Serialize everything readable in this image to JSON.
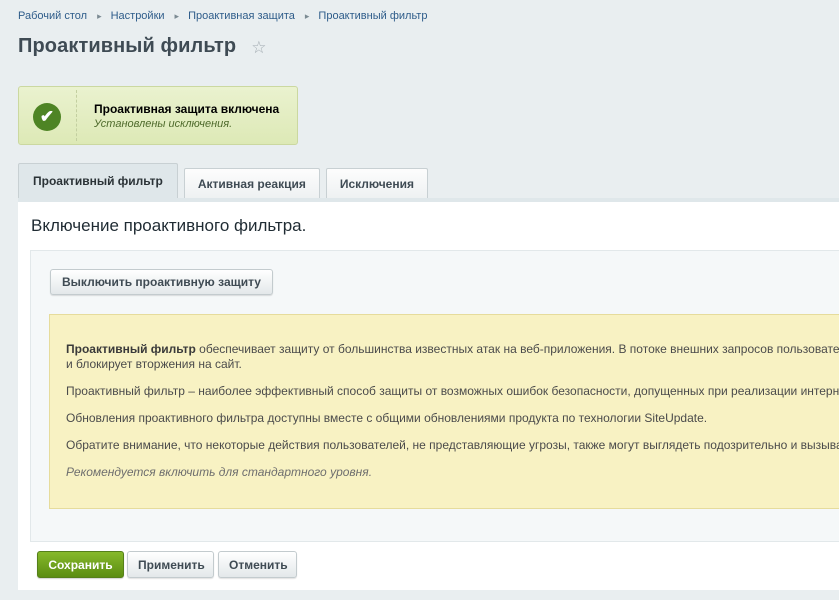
{
  "breadcrumb": {
    "items": [
      "Рабочий стол",
      "Настройки",
      "Проактивная защита",
      "Проактивный фильтр"
    ],
    "separator": "▸"
  },
  "page": {
    "title": "Проактивный фильтр",
    "favorite_icon": "star-icon"
  },
  "status": {
    "icon": "check-circle-icon",
    "title": "Проактивная защита включена",
    "subtitle": "Установлены исключения."
  },
  "tabs": [
    {
      "label": "Проактивный фильтр",
      "active": true
    },
    {
      "label": "Активная реакция",
      "active": false
    },
    {
      "label": "Исключения",
      "active": false
    }
  ],
  "main": {
    "heading": "Включение проактивного фильтра.",
    "disable_button": "Выключить проактивную защиту",
    "info": {
      "p1_bold": "Проактивный фильтр",
      "p1_rest": " обеспечивает защиту от большинства известных атак на веб-приложения. В потоке внешних запросов пользователей п",
      "p1_line2": "и блокирует вторжения на сайт.",
      "p2": "Проактивный фильтр – наиболее эффективный способ защиты от возможных ошибок безопасности, допущенных при реализации интернет-про",
      "p3": "Обновления проактивного фильтра доступны вместе с общими обновлениями продукта по технологии SiteUpdate.",
      "p4": "Обратите внимание, что некоторые действия пользователей, не представляющие угрозы, также могут выглядеть подозрительно и вызывать ло",
      "p5": "Рекомендуется включить для стандартного уровня."
    }
  },
  "footer": {
    "save": "Сохранить",
    "apply": "Применить",
    "cancel": "Отменить"
  },
  "colors": {
    "save_button": "#6a9f1c",
    "status_bg": "#e3edc4",
    "info_bg": "#f8f2c3",
    "link": "#2e5c8a"
  }
}
